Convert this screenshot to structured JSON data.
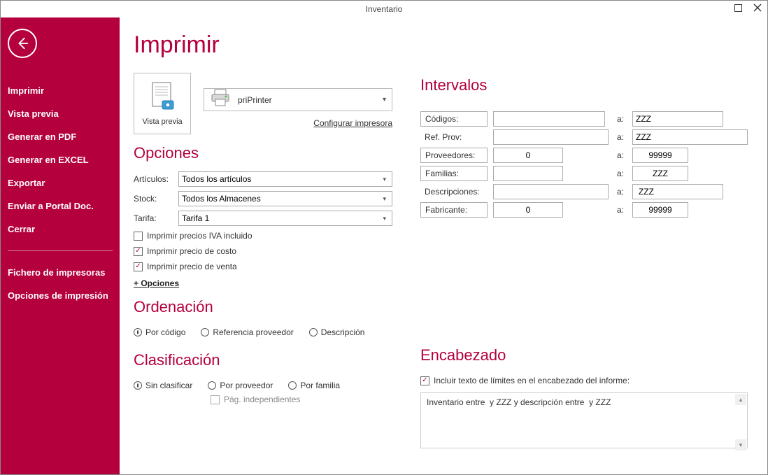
{
  "window": {
    "title": "Inventario"
  },
  "sidebar": {
    "items": [
      "Imprimir",
      "Vista previa",
      "Generar en PDF",
      "Generar en EXCEL",
      "Exportar",
      "Enviar a Portal Doc.",
      "Cerrar"
    ],
    "items2": [
      "Fichero de impresoras",
      "Opciones de impresión"
    ]
  },
  "page": {
    "title": "Imprimir",
    "preview_label": "Vista previa",
    "printer_name": "priPrinter",
    "config_link": "Configurar impresora"
  },
  "opciones": {
    "title": "Opciones",
    "articulos_label": "Artículos:",
    "articulos_value": "Todos los artículos",
    "stock_label": "Stock:",
    "stock_value": "Todos los Almacenes",
    "tarifa_label": "Tarifa:",
    "tarifa_value": "Tarifa 1",
    "chk_iva": "Imprimir precios IVA incluido",
    "chk_costo": "Imprimir precio de costo",
    "chk_venta": "Imprimir precio de venta",
    "mas_opciones": "+ Opciones"
  },
  "ordenacion": {
    "title": "Ordenación",
    "por_codigo": "Por código",
    "ref_prov": "Referencia proveedor",
    "descripcion": "Descripción"
  },
  "clasificacion": {
    "title": "Clasificación",
    "sin": "Sin clasificar",
    "por_prov": "Por proveedor",
    "por_fam": "Por familia",
    "pag_indep": "Pág. independientes"
  },
  "intervalos": {
    "title": "Intervalos",
    "a": "a:",
    "codigos_label": "Códigos:",
    "codigos_from": "",
    "codigos_to": "ZZZ",
    "refprov_label": "Ref. Prov:",
    "refprov_from": "",
    "refprov_to": "ZZZ",
    "prov_label": "Proveedores:",
    "prov_from": "0",
    "prov_to": "99999",
    "fam_label": "Familias:",
    "fam_from": "",
    "fam_to": "ZZZ",
    "desc_label": "Descripciones:",
    "desc_from": "",
    "desc_to": "ZZZ",
    "fab_label": "Fabricante:",
    "fab_from": "0",
    "fab_to": "99999"
  },
  "encabezado": {
    "title": "Encabezado",
    "chk_label": "Incluir texto de límites en el encabezado del informe:",
    "text": "Inventario entre  y ZZZ y descripción entre  y ZZZ"
  }
}
